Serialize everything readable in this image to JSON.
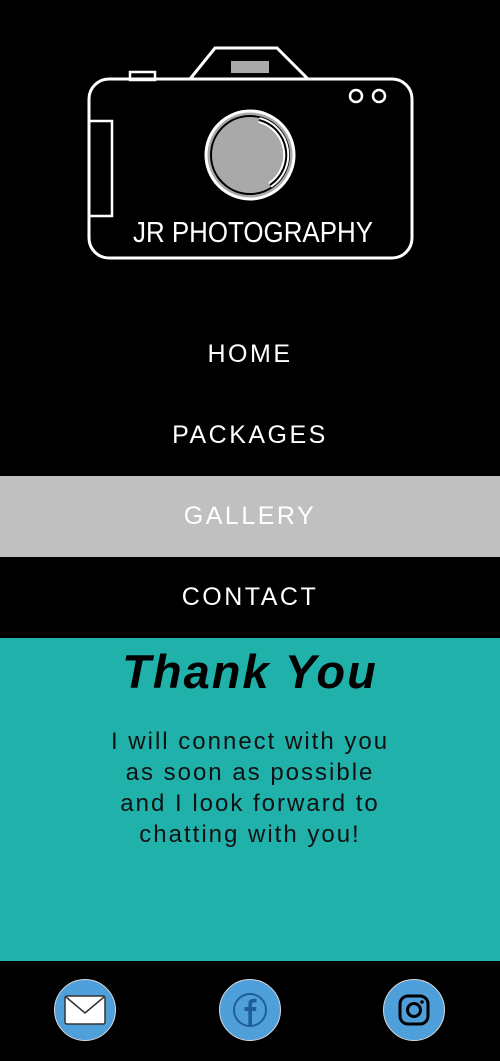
{
  "brand": {
    "logo_text": "JR PHOTOGRAPHY",
    "logo_icon": "camera-icon"
  },
  "nav": {
    "items": [
      {
        "label": "HOME",
        "active": false
      },
      {
        "label": "PACKAGES",
        "active": false
      },
      {
        "label": "GALLERY",
        "active": true
      },
      {
        "label": "CONTACT",
        "active": false
      }
    ]
  },
  "main": {
    "title": "Thank You",
    "message": "I will connect with you as soon as possible and I look forward to chatting with you!"
  },
  "footer": {
    "social": [
      {
        "icon": "envelope-icon",
        "network": "email"
      },
      {
        "icon": "facebook-icon",
        "network": "facebook"
      },
      {
        "icon": "instagram-icon",
        "network": "instagram"
      }
    ]
  },
  "colors": {
    "background": "#000000",
    "nav_active": "#c0c0c0",
    "content_bg": "#20b2aa",
    "social_bg": "#4f9fdb"
  }
}
